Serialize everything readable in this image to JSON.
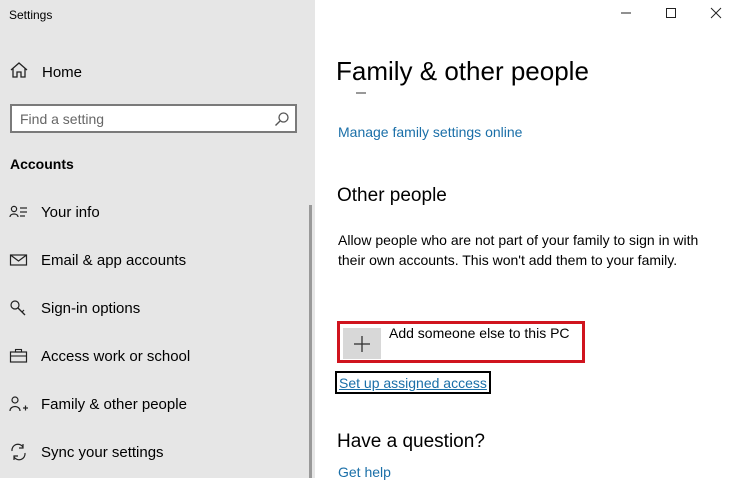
{
  "window": {
    "title": "Settings"
  },
  "sidebar": {
    "home_label": "Home",
    "search_placeholder": "Find a setting",
    "section_title": "Accounts",
    "items": [
      {
        "label": "Your info",
        "icon": "person-card-icon"
      },
      {
        "label": "Email & app accounts",
        "icon": "mail-icon"
      },
      {
        "label": "Sign-in options",
        "icon": "key-icon"
      },
      {
        "label": "Access work or school",
        "icon": "briefcase-icon"
      },
      {
        "label": "Family & other people",
        "icon": "people-add-icon"
      },
      {
        "label": "Sync your settings",
        "icon": "sync-icon"
      }
    ]
  },
  "main": {
    "title": "Family & other people",
    "manage_link": "Manage family settings online",
    "other_people_heading": "Other people",
    "description": "Allow people who are not part of your family to sign in with their own accounts. This won't add them to your family.",
    "add_label": "Add someone else to this PC",
    "assigned_access_link": "Set up assigned access",
    "question_heading": "Have a question?",
    "help_link": "Get help"
  },
  "colors": {
    "sidebar_bg": "#e6e6e6",
    "link": "#1a6fa8",
    "highlight_border": "#d0141e"
  }
}
